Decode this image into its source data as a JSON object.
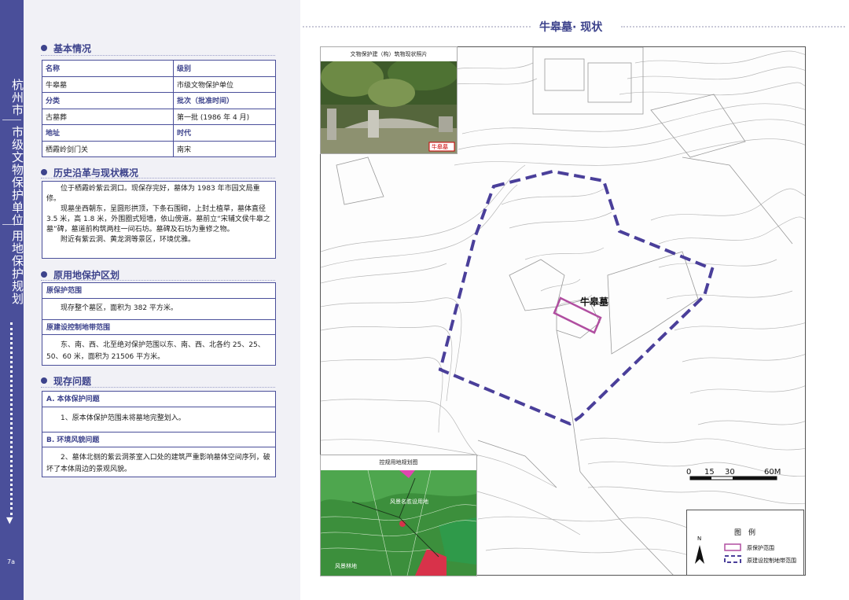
{
  "spine": {
    "city": "杭州市",
    "category": "市级文物保护单位",
    "topic": "用地保护规划",
    "page": "7a"
  },
  "right": {
    "title": "牛皋墓· 现状"
  },
  "basic": {
    "heading": "基本情况",
    "rows": [
      [
        "名称",
        "级别"
      ],
      [
        "牛皋墓",
        "市级文物保护单位"
      ],
      [
        "分类",
        "批次（批准时间）"
      ],
      [
        "古墓葬",
        "第一批 (1986 年 4 月)"
      ],
      [
        "地址",
        "时代"
      ],
      [
        "栖霞岭剑门关",
        "南宋"
      ]
    ]
  },
  "history": {
    "heading": "历史沿革与现状概况",
    "paragraphs": [
      "位于栖霞岭紫云洞口。现保存完好，墓体为 1983 年市园文局重修。",
      "现墓坐西朝东，呈圆形拱顶，下条石围砌，上封土植草，墓体直径 3.5 米，高 1.8 米，外围圈式短墙，依山傍道。墓前立“宋辅文侯牛皋之墓”碑，墓道前构筑两柱一间石坊。墓碑及石坊为重修之物。",
      "附近有紫云洞、黄龙洞等景区，环境优雅。"
    ]
  },
  "zone": {
    "heading": "原用地保护区划",
    "protect_title": "原保护范围",
    "protect_text": "现存整个墓区，面积为 382 平方米。",
    "control_title": "原建设控制地带范围",
    "control_text": "东、南、西、北至绝对保护范围以东、南、西、北各约 25、25、50、60 米，面积为 21506 平方米。"
  },
  "issues": {
    "heading": "现存问题",
    "a_title": "A. 本体保护问题",
    "a_text": "1、原本体保护范围未将墓地完整划入。",
    "b_title": "B. 环境风貌问题",
    "b_text": "2、墓体北侧的紫云洞茶室入口处的建筑严重影响墓体空间序列，破坏了本体周边的景观风貌。"
  },
  "map": {
    "tomb_label": "牛皋墓",
    "photo_caption": "文物保护建（构）筑物现状照片",
    "photo_tag": "牛皋墓",
    "plan_caption": "控规用地规划图",
    "plan_labels": [
      "风景名胜设用地",
      "风景林地"
    ],
    "scale_labels": [
      "0",
      "15",
      "30",
      "60M"
    ],
    "north": "N",
    "legend_title": "图　例",
    "legend_items": [
      "原保护范围",
      "原建设控制地带范围"
    ]
  },
  "colors": {
    "accent": "#3d438c",
    "spine": "#4a4f9a",
    "protect": "#b04ea0",
    "control": "#4a3f9a"
  }
}
